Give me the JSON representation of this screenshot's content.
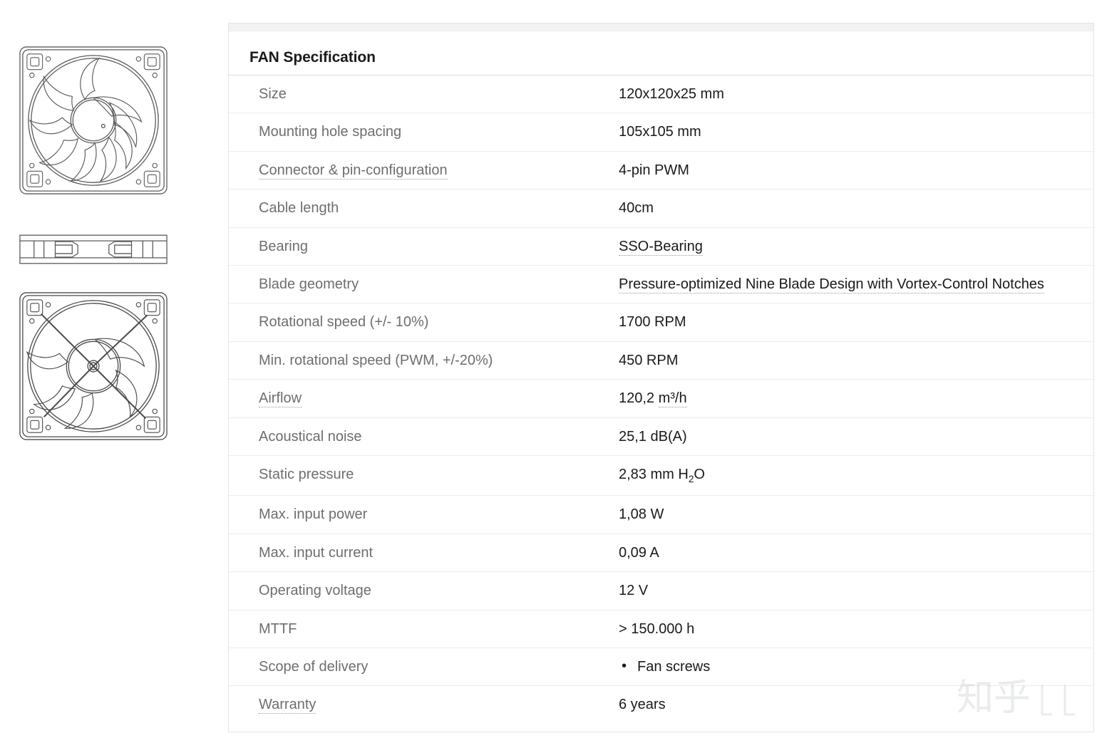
{
  "card": {
    "title": "FAN Specification"
  },
  "gallery": {
    "images": [
      {
        "name": "fan-front-view",
        "alt": "Fan front view line drawing"
      },
      {
        "name": "fan-side-view",
        "alt": "Fan side profile line drawing"
      },
      {
        "name": "fan-rear-view",
        "alt": "Fan rear view line drawing"
      }
    ]
  },
  "spec_rows": [
    {
      "label": "Size",
      "label_tooltip": false,
      "value": "120x120x25 mm",
      "value_tooltip": false
    },
    {
      "label": "Mounting hole spacing",
      "label_tooltip": false,
      "value": "105x105 mm",
      "value_tooltip": false
    },
    {
      "label": "Connector & pin-configuration",
      "label_tooltip": true,
      "value": "4-pin PWM",
      "value_tooltip": false
    },
    {
      "label": "Cable length",
      "label_tooltip": false,
      "value": "40cm",
      "value_tooltip": false
    },
    {
      "label": "Bearing",
      "label_tooltip": false,
      "value": "SSO-Bearing",
      "value_tooltip": true
    },
    {
      "label": "Blade geometry",
      "label_tooltip": false,
      "value": "Pressure-optimized Nine Blade Design with Vortex-Control Notches",
      "value_tooltip": true
    },
    {
      "label": "Rotational speed (+/- 10%)",
      "label_tooltip": false,
      "value": "1700 RPM",
      "value_tooltip": false
    },
    {
      "label": "Min. rotational speed (PWM, +/-20%)",
      "label_tooltip": false,
      "value": "450 RPM",
      "value_tooltip": false
    },
    {
      "label": "Airflow",
      "label_tooltip": true,
      "value_number": "120,2 ",
      "value_unit": "m³/h",
      "value_unit_tooltip": true
    },
    {
      "label": "Acoustical noise",
      "label_tooltip": false,
      "value": "25,1 dB(A)",
      "value_tooltip": false
    },
    {
      "label": "Static pressure",
      "label_tooltip": false,
      "value_html_prefix": "2,83 mm H",
      "value_sub": "2",
      "value_html_suffix": "O"
    },
    {
      "label": "Max. input power",
      "label_tooltip": false,
      "value": "1,08 W",
      "value_tooltip": false
    },
    {
      "label": "Max. input current",
      "label_tooltip": false,
      "value": "0,09 A",
      "value_tooltip": false
    },
    {
      "label": "Operating voltage",
      "label_tooltip": false,
      "value": "12 V",
      "value_tooltip": false
    },
    {
      "label": "MTTF",
      "label_tooltip": false,
      "value": "> 150.000 h",
      "value_tooltip": false
    },
    {
      "label": "Scope of delivery",
      "label_tooltip": false,
      "value_list": [
        "Fan screws"
      ]
    },
    {
      "label": "Warranty",
      "label_tooltip": true,
      "value": "6 years",
      "value_tooltip": false
    }
  ],
  "watermark": {
    "text": "知乎"
  },
  "colors": {
    "label_text": "#6e6e6e",
    "value_text": "#1a1a1a",
    "row_divider": "#ececec",
    "card_border": "#e3e3e3",
    "top_strip": "#f2f2f2",
    "tooltip_underline": "#9a9a9a"
  }
}
